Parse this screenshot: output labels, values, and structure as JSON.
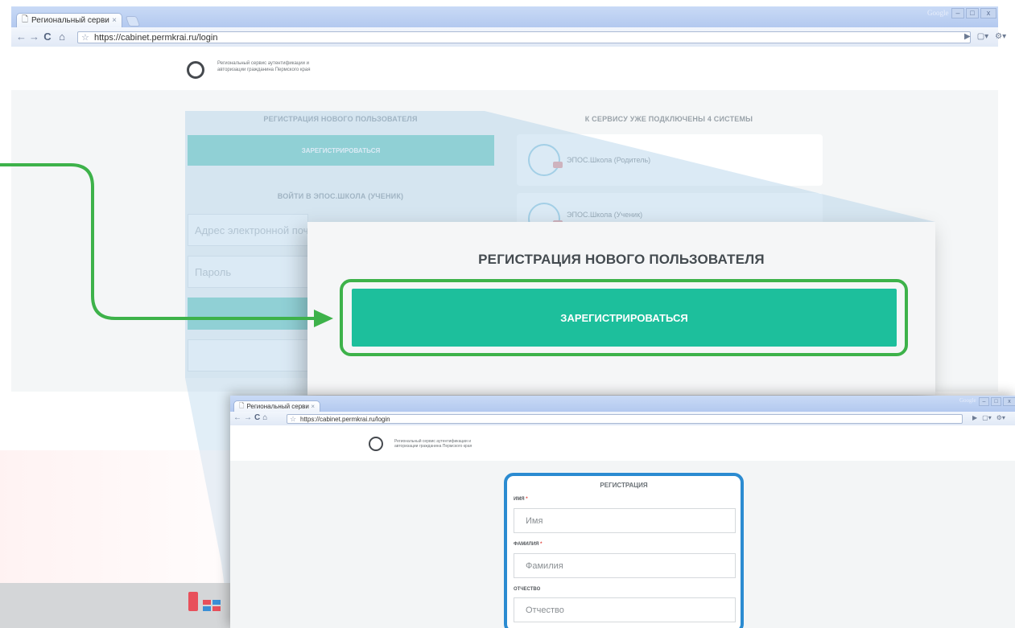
{
  "browser": {
    "tab_title": "Региональный серви",
    "tab_close": "×",
    "url": "https://cabinet.permkrai.ru/login",
    "brand": "Google",
    "win_buttons": [
      "–",
      "□",
      "x"
    ]
  },
  "site": {
    "logo_line1": "Региональный сервис аутентификации и",
    "logo_line2": "авторизации гражданина Пермского края"
  },
  "left_column": {
    "registration_header": "РЕГИСТРАЦИЯ НОВОГО ПОЛЬЗОВАТЕЛЯ",
    "register_button": "ЗАРЕГИСТРИРОВАТЬСЯ",
    "login_header": "ВОЙТИ В ЭПОС.ШКОЛА (УЧЕНИК)",
    "email_placeholder": "Адрес электронной почт",
    "password_placeholder": "Пароль"
  },
  "right_column": {
    "systems_header": "К СЕРВИСУ УЖЕ ПОДКЛЮЧЕНЫ 4 СИСТЕМЫ",
    "systems": [
      "ЭПОС.Школа (Родитель)",
      "ЭПОС.Школа (Ученик)"
    ]
  },
  "zoom": {
    "title": "РЕГИСТРАЦИЯ НОВОГО ПОЛЬЗОВАТЕЛЯ",
    "register_button": "ЗАРЕГИСТРИРОВАТЬСЯ"
  },
  "registration_form": {
    "title": "РЕГИСТРАЦИЯ",
    "required_mark": "*",
    "fields": [
      {
        "label": "ИМЯ",
        "required": true,
        "placeholder": "Имя"
      },
      {
        "label": "ФАМИЛИЯ",
        "required": true,
        "placeholder": "Фамилия"
      },
      {
        "label": "ОТЧЕСТВО",
        "required": false,
        "placeholder": "Отчество"
      }
    ]
  },
  "colors": {
    "accent_green": "#1dbf9c",
    "highlight_green": "#3db24a",
    "highlight_blue": "#2b8bd1"
  }
}
